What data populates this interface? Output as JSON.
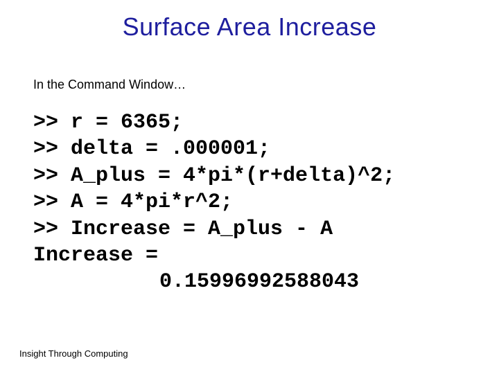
{
  "title": "Surface Area Increase",
  "subtitle": "In the Command Window…",
  "code": {
    "l1": ">> r = 6365;",
    "l2": ">> delta = .000001;",
    "l3": ">> A_plus = 4*pi*(r+delta)^2;",
    "l4": ">> A = 4*pi*r^2;",
    "l5": ">> Increase = A_plus - A",
    "l6": "Increase =",
    "l7": "0.15996992588043"
  },
  "footer": "Insight Through Computing"
}
